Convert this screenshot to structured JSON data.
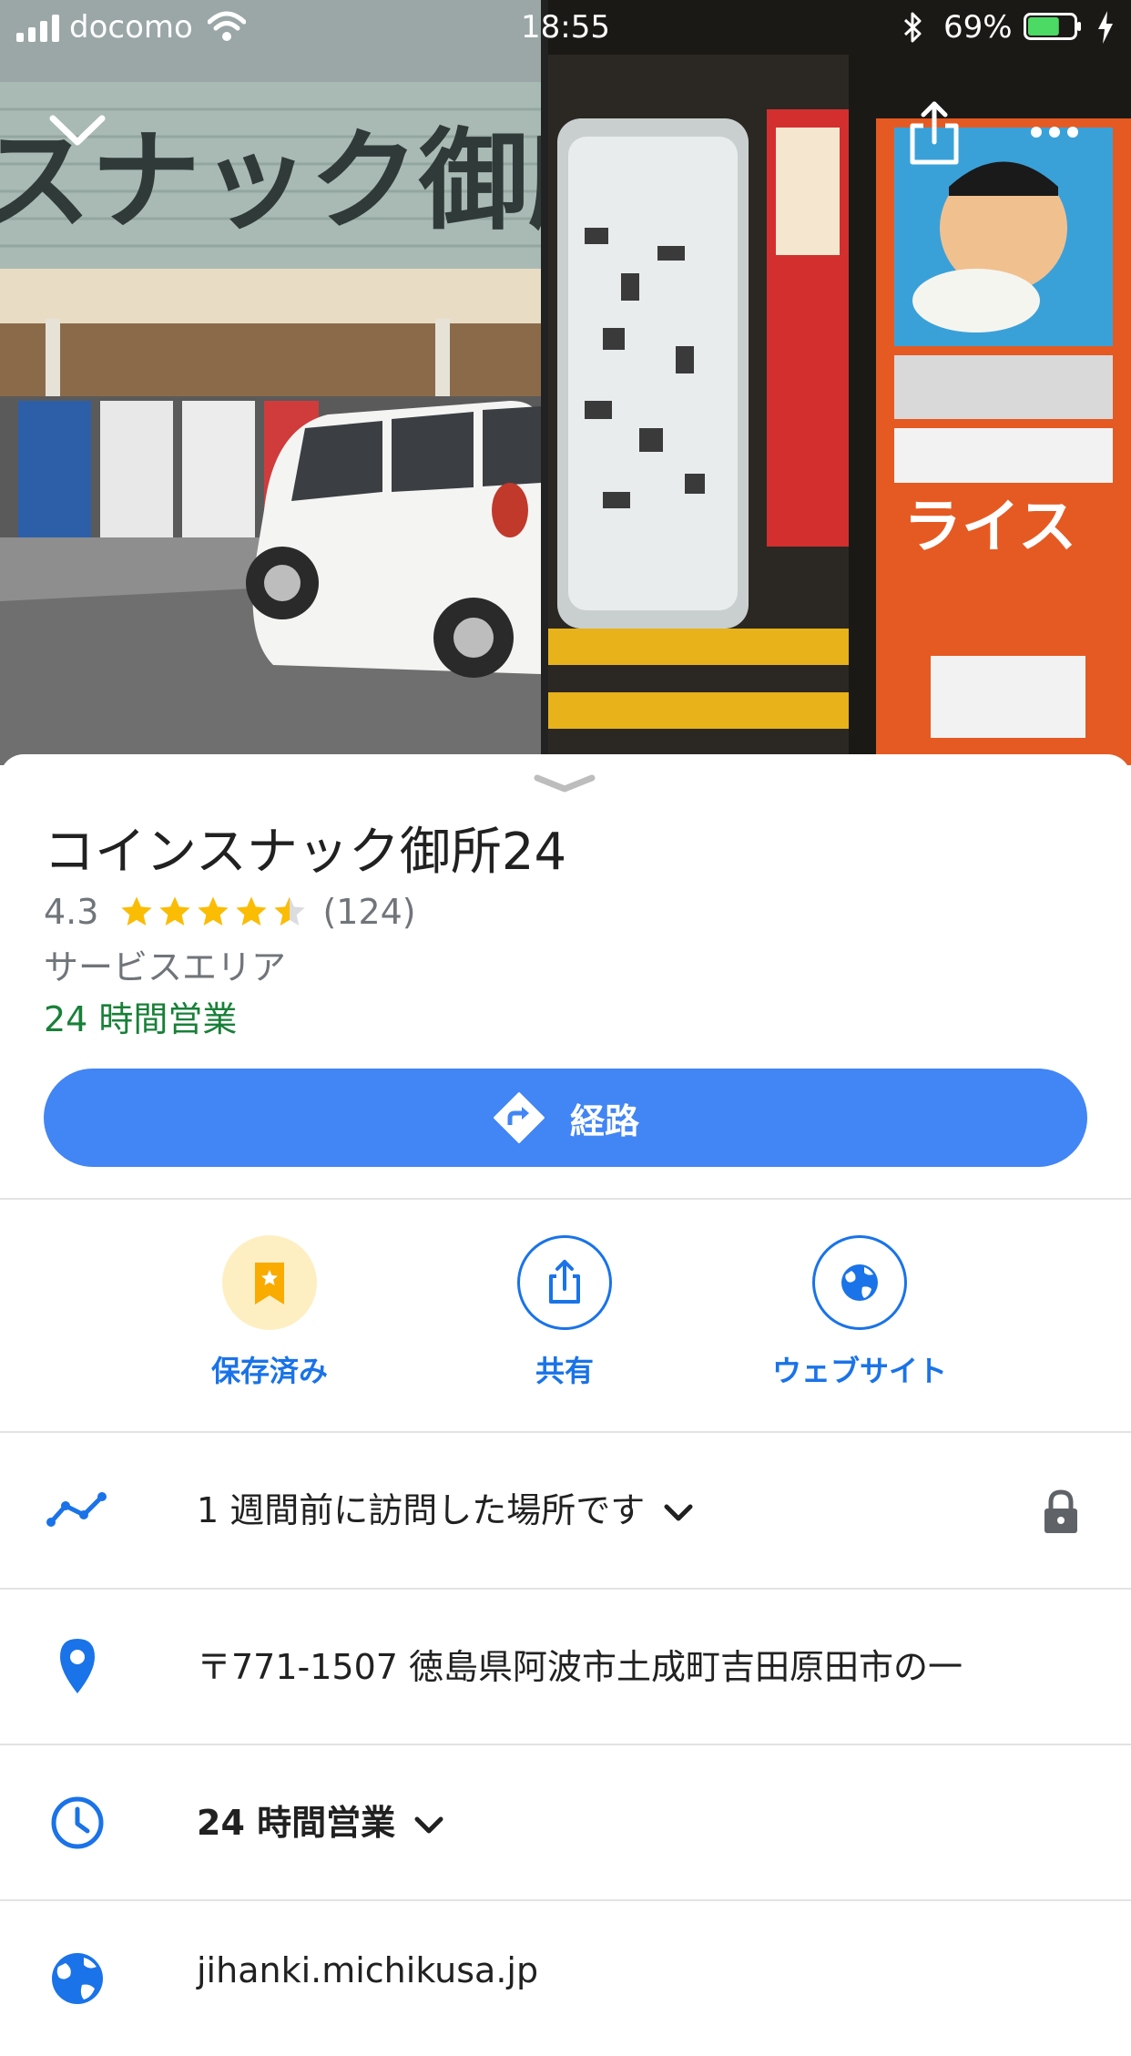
{
  "status_bar": {
    "carrier": "docomo",
    "time": "18:55",
    "battery_percent": "69%",
    "battery_level": 0.69
  },
  "header": {
    "collapse_icon": "chevron-down-icon",
    "share_icon": "share-icon",
    "more_icon": "more-horizontal-icon"
  },
  "place": {
    "name": "コインスナック御所24",
    "rating": "4.3",
    "rating_value": 4.3,
    "review_count": "(124)",
    "category": "サービスエリア",
    "open_status": "24 時間営業"
  },
  "directions": {
    "label": "経路",
    "icon": "directions-icon"
  },
  "actions": [
    {
      "label": "保存済み",
      "icon": "bookmark-star-icon"
    },
    {
      "label": "共有",
      "icon": "share-icon"
    },
    {
      "label": "ウェブサイト",
      "icon": "globe-icon"
    }
  ],
  "details": {
    "visit": {
      "text": "1 週間前に訪問した場所です",
      "icon": "timeline-icon",
      "trailing_icon": "lock-icon"
    },
    "address": {
      "text": "〒771-1507 徳島県阿波市土成町吉田原田市の一",
      "icon": "location-pin-icon"
    },
    "hours": {
      "text": "24 時間営業",
      "icon": "clock-icon"
    },
    "website": {
      "text": "jihanki.michikusa.jp",
      "icon": "globe-icon"
    }
  },
  "colors": {
    "accent": "#1a73e8",
    "button": "#4285f4",
    "open_green": "#188038",
    "star": "#fbbc04",
    "saved_bg": "#feefc3"
  }
}
